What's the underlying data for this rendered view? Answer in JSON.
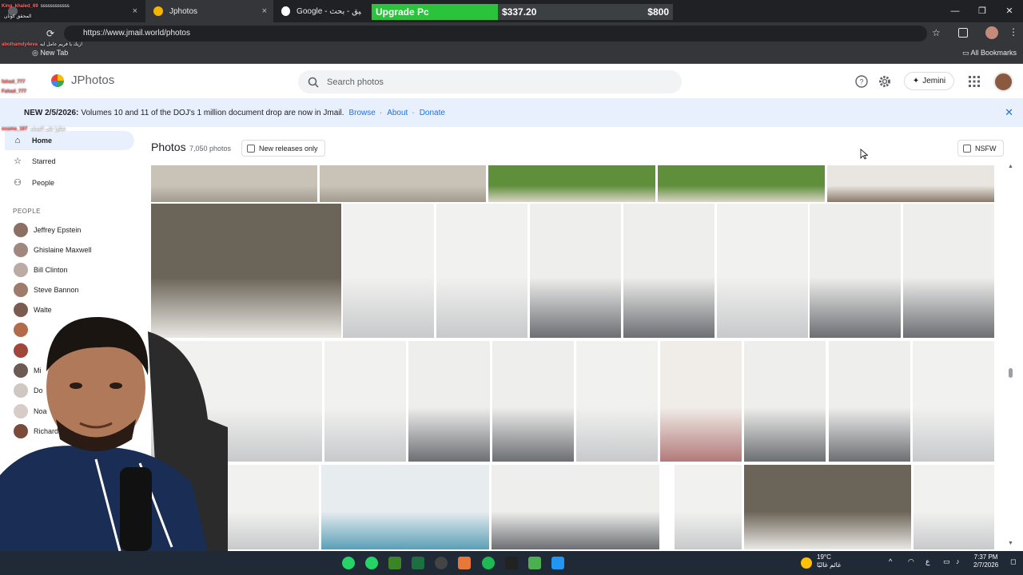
{
  "browser": {
    "tabs": [
      {
        "label": "",
        "close": "×"
      },
      {
        "label": "Jphotos",
        "close": "×"
      },
      {
        "label": "Google - خالد توفيق - بحث",
        "close": "×"
      }
    ],
    "new_tab_label": "New Tab",
    "url": "https://www.jmail.world/photos",
    "all_bookmarks": "All Bookmarks",
    "window_controls": [
      "—",
      "❐",
      "✕"
    ]
  },
  "stream_overlay": {
    "upgrade_label": "Upgrade Pc",
    "current_amount": "$337.20",
    "goal_amount": "$800",
    "progress_percent": 42
  },
  "chat": [
    {
      "user": "King_khaled_69",
      "msg": "ssssssssssss"
    },
    {
      "user": "",
      "msg": "المحقق كونان"
    },
    {
      "user": "",
      "msg": ""
    },
    {
      "user": "abolhamdy4eva",
      "msg": "ازيك يا فريم عامل ايه"
    },
    {
      "user": "fahad_777",
      "msg": ""
    },
    {
      "user": "Fahad_777",
      "msg": ""
    },
    {
      "user": "osama_167",
      "msg": "شكرا على الجمايه"
    }
  ],
  "app": {
    "brand": "JPhotos",
    "search_placeholder": "Search photos",
    "jemini_label": "Jemini",
    "banner": {
      "new_label": "NEW 2/5/2026:",
      "text": "Volumes 10 and 11 of the DOJ's 1 million document drop are now in Jmail.",
      "link_browse": "Browse",
      "separator": "·",
      "link_about": "About",
      "link_donate": "Donate"
    },
    "sidebar": {
      "nav": [
        {
          "label": "Home",
          "icon": "home-icon",
          "active": true
        },
        {
          "label": "Starred",
          "icon": "star-icon",
          "active": false
        },
        {
          "label": "People",
          "icon": "people-icon",
          "active": false
        }
      ],
      "people_heading": "PEOPLE",
      "people": [
        {
          "name": "Jeffrey Epstein",
          "color": "#8d6e63"
        },
        {
          "name": "Ghislaine Maxwell",
          "color": "#a1887f"
        },
        {
          "name": "Bill Clinton",
          "color": "#bcaaa4"
        },
        {
          "name": "Steve Bannon",
          "color": "#9e7b6b"
        },
        {
          "name": "Walte",
          "color": "#7a5c4e"
        },
        {
          "name": "",
          "color": "#b36b4c"
        },
        {
          "name": "",
          "color": "#a0463a"
        },
        {
          "name": "Mi",
          "color": "#6d5a52"
        },
        {
          "name": "Do",
          "color": "#cfc7c2"
        },
        {
          "name": "Noa",
          "color": "#d7ccc8"
        },
        {
          "name": "Richard",
          "color": "#7b4a3a"
        }
      ]
    },
    "photos": {
      "title": "Photos",
      "count": "7,050 photos",
      "new_releases_label": "New releases only",
      "nsfw_label": "NSFW"
    }
  },
  "taskbar": {
    "weather_temp": "19°C",
    "weather_desc": "غائم غالبًا",
    "time": "7:37 PM",
    "date": "2/7/2026",
    "lang": "ع"
  }
}
